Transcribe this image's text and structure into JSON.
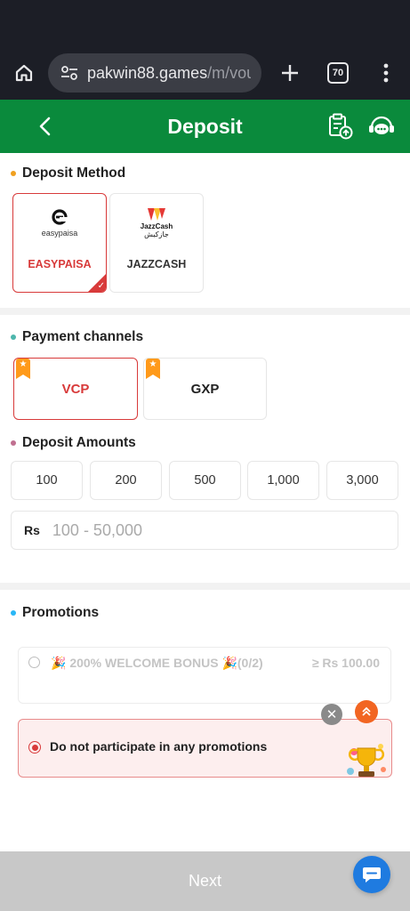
{
  "browser": {
    "url_main": "pakwin88.games",
    "url_path": "/m/vouc",
    "tab_count": "70"
  },
  "header": {
    "title": "Deposit"
  },
  "deposit_method": {
    "title": "Deposit Method",
    "dot_color": "#f0a020",
    "methods": [
      {
        "label": "EASYPAISA",
        "logo_text": "easypaisa",
        "selected": true
      },
      {
        "label": "JAZZCASH",
        "logo_text": "JazzCash",
        "logo_urdu": "جازکیش",
        "selected": false
      }
    ]
  },
  "payment_channels": {
    "title": "Payment channels",
    "dot_color": "#4db6ac",
    "channels": [
      {
        "label": "VCP",
        "selected": true
      },
      {
        "label": "GXP",
        "selected": false
      }
    ]
  },
  "deposit_amounts": {
    "title": "Deposit Amounts",
    "dot_color": "#c07090",
    "options": [
      "100",
      "200",
      "500",
      "1,000",
      "3,000"
    ],
    "currency": "Rs",
    "placeholder": "100 - 50,000"
  },
  "promotions": {
    "title": "Promotions",
    "dot_color": "#29b6f6",
    "items": [
      {
        "text": "🎉 200% WELCOME BONUS 🎉(0/2)",
        "min": "≥ Rs 100.00"
      }
    ],
    "no_participate": "Do not participate in any promotions"
  },
  "footer": {
    "next_label": "Next"
  },
  "colors": {
    "brand_green": "#0a8a3c",
    "accent_red": "#d83a3a"
  }
}
